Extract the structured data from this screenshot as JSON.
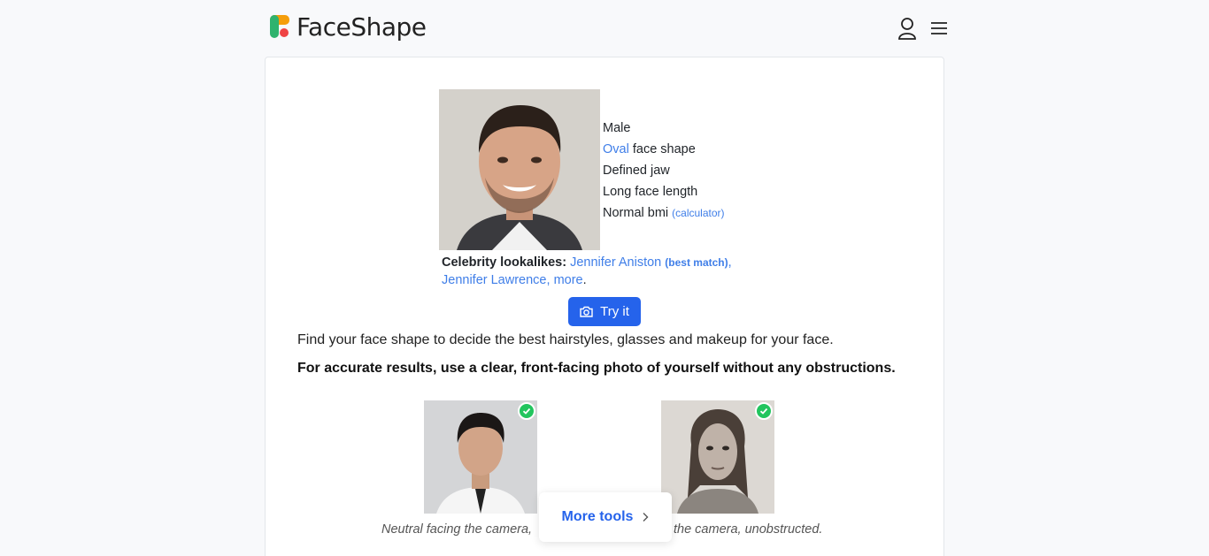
{
  "header": {
    "logo_text": "FaceShape",
    "icons": [
      "user-icon",
      "menu-icon"
    ]
  },
  "sample": {
    "attributes": {
      "gender": "Male",
      "face_shape_link": "Oval",
      "face_shape_suffix": " face shape",
      "jaw": "Defined jaw",
      "length": "Long face length",
      "bmi": "Normal bmi ",
      "bmi_link": "(calculator)"
    },
    "lookalikes": {
      "label": "Celebrity lookalikes:",
      "first": "Jennifer Aniston",
      "best_match": "(best match)",
      "second": "Jennifer Lawrence",
      "more": "more"
    }
  },
  "try_button": "Try it",
  "intro_text": "Find your face shape to decide the best hairstyles, glasses and makeup for your face.",
  "advice_text": "For accurate results, use a clear, front-facing photo of yourself without any obstructions.",
  "examples": {
    "caption_left": "Neutral facing the camera,",
    "caption_right": "the camera, unobstructed."
  },
  "more_tools": "More tools",
  "colors": {
    "link": "#3f7ee8",
    "primary": "#2563eb",
    "check": "#22c55e",
    "logo_green": "#2fb36e",
    "logo_orange": "#f59e0b",
    "logo_red": "#ef4444"
  }
}
